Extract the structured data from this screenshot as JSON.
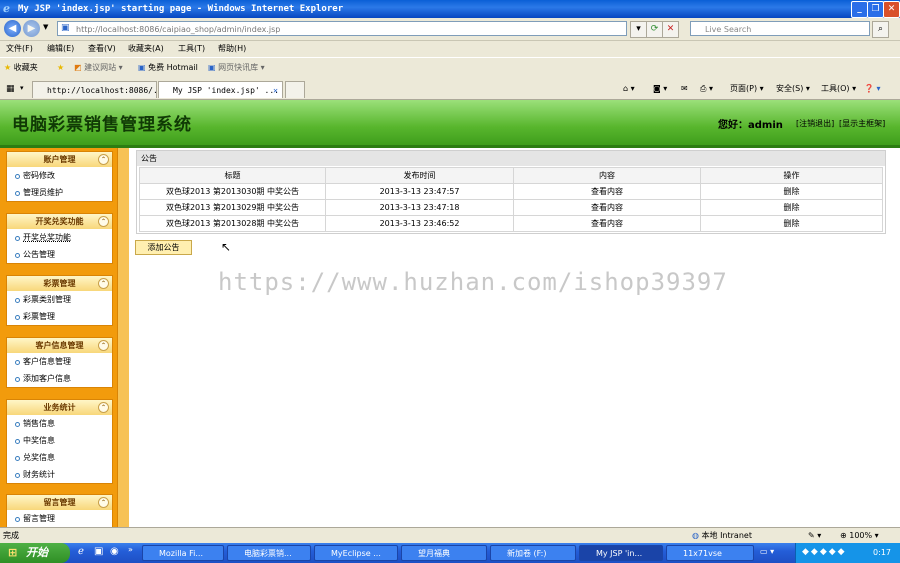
{
  "window": {
    "title": "My JSP 'index.jsp' starting page - Windows Internet Explorer",
    "minimize": "_",
    "maximize": "❐",
    "close": "✕"
  },
  "address_bar": {
    "url": "http://localhost:8086/caipiao_shop/admin/index.jsp",
    "search_placeholder": "Live Search"
  },
  "menu": [
    "文件(F)",
    "编辑(E)",
    "查看(V)",
    "收藏夹(A)",
    "工具(T)",
    "帮助(H)"
  ],
  "favorites_bar": {
    "favorites": "收藏夹",
    "suggested_sites": "建议网站 ▾",
    "hotmail": "免费 Hotmail",
    "web_slice": "网页快讯库 ▾"
  },
  "tabs": [
    {
      "label": "http://localhost:8086/..."
    },
    {
      "label": "My JSP 'index.jsp' ..."
    }
  ],
  "toolbar": {
    "page": "页面(P) ▾",
    "safety": "安全(S) ▾",
    "tools": "工具(O) ▾",
    "help": "❓ ▾"
  },
  "header": {
    "system_title": "电脑彩票销售管理系统",
    "greeting": "您好：admin",
    "logout": "[注销退出]",
    "show_frame": "[显示主框架]"
  },
  "sidebar": [
    {
      "title": "账户管理",
      "items": [
        "密码修改",
        "管理员维护"
      ]
    },
    {
      "title": "开奖兑奖功能",
      "items": [
        "开奖兑奖功能",
        "公告管理"
      ]
    },
    {
      "title": "彩票管理",
      "items": [
        "彩票类别管理",
        "彩票管理"
      ]
    },
    {
      "title": "客户信息管理",
      "items": [
        "客户信息管理",
        "添加客户信息"
      ]
    },
    {
      "title": "业务统计",
      "items": [
        "销售信息",
        "中奖信息",
        "兑奖信息",
        "财务统计"
      ]
    },
    {
      "title": "留言管理",
      "items": [
        "留言管理"
      ]
    }
  ],
  "notice_panel": {
    "title": "公告",
    "columns": [
      "标题",
      "发布时间",
      "内容",
      "操作"
    ],
    "rows": [
      {
        "title": "双色球2013 第2013030期 中奖公告",
        "time": "2013-3-13 23:47:57",
        "content": "查看内容",
        "action": "删除"
      },
      {
        "title": "双色球2013 第2013029期 中奖公告",
        "time": "2013-3-13 23:47:18",
        "content": "查看内容",
        "action": "删除"
      },
      {
        "title": "双色球2013 第2013028期 中奖公告",
        "time": "2013-3-13 23:46:52",
        "content": "查看内容",
        "action": "删除"
      }
    ],
    "add_button": "添加公告"
  },
  "watermark": "https://www.huzhan.com/ishop39397",
  "status_bar": {
    "status": "完成",
    "zone": "本地 Intranet",
    "zoom": "100%"
  },
  "taskbar": {
    "start": "开始",
    "tasks": [
      "Mozilla Fi...",
      "电脑彩票销...",
      "MyEclipse ...",
      "望月福典",
      "新加卷 (F:)",
      "My JSP 'in...",
      "11x71vse"
    ],
    "clock": "0:17"
  }
}
